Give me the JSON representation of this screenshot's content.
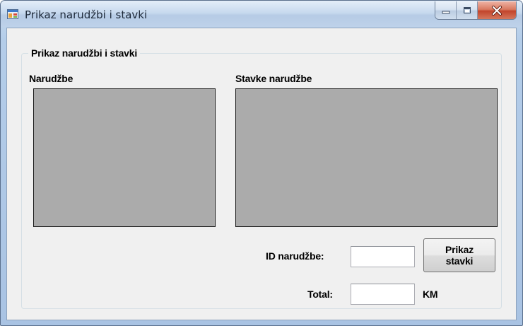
{
  "window": {
    "title": "Prikaz narudžbi i stavki"
  },
  "caption_buttons": {
    "minimize_icon": "minimize-icon",
    "maximize_icon": "maximize-icon",
    "close_icon": "close-icon"
  },
  "group": {
    "legend": "Prikaz narudžbi i stavki"
  },
  "orders": {
    "label": "Narudžbe"
  },
  "items": {
    "label": "Stavke narudžbe"
  },
  "order_id": {
    "label": "ID narudžbe:",
    "value": ""
  },
  "show_items_button": {
    "line1": "Prikaz",
    "line2": "stavki"
  },
  "total": {
    "label": "Total:",
    "value": "",
    "unit": "KM"
  },
  "colors": {
    "grid_background": "#ababab",
    "form_background": "#f0f0f0",
    "close_button": "#c2452c"
  }
}
